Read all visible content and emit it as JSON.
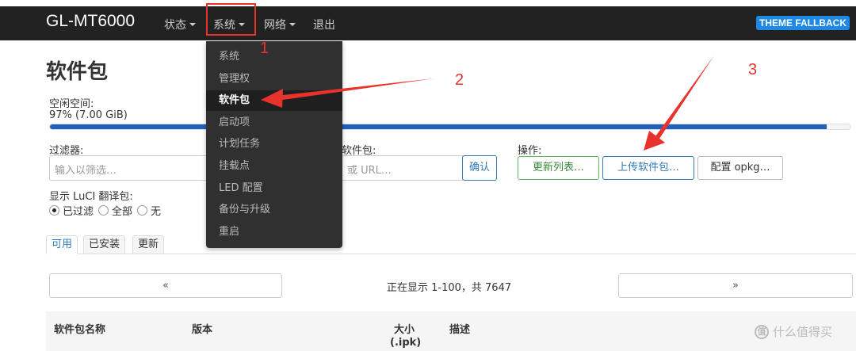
{
  "navbar": {
    "brand": "GL-MT6000",
    "items": [
      "状态",
      "系统",
      "网络",
      "退出"
    ],
    "theme_badge": "THEME FALLBACK"
  },
  "page": {
    "title": "软件包",
    "free_space_label": "空闲空间:",
    "free_space_value": "97% (7.00 GiB)",
    "free_space_fraction": 0.97,
    "filter_label": "过滤器:",
    "filter_placeholder": "输入以筛选…",
    "download_label": "软件包:",
    "download_placeholder": "或 URL…",
    "confirm_button": "确认",
    "actions_label": "操作:",
    "update_lists_button": "更新列表…",
    "upload_button": "上传软件包…",
    "configure_button": "配置 opkg…",
    "luci_translations_label": "显示 LuCI 翻译包:",
    "radio_options": [
      "已过滤",
      "全部",
      "无"
    ],
    "radio_selected": "已过滤"
  },
  "tabs": [
    "可用",
    "已安装",
    "更新"
  ],
  "pager": {
    "prev": "«",
    "next": "»",
    "status": "正在显示 1-100，共 7647"
  },
  "table_headers": {
    "name": "软件包名称",
    "version": "版本",
    "size": "大小",
    "size_unit": "(.ipk)",
    "description": "描述"
  },
  "dropdown": {
    "items": [
      "系统",
      "管理权",
      "软件包",
      "启动项",
      "计划任务",
      "挂载点",
      "LED 配置",
      "备份与升级",
      "重启"
    ],
    "active": "软件包"
  },
  "annotations": [
    "1",
    "2",
    "3"
  ],
  "watermark": "什么值得买",
  "colors": {
    "navbar": "#222222",
    "accent": "#1e62c0",
    "annotation": "#e8322b"
  }
}
